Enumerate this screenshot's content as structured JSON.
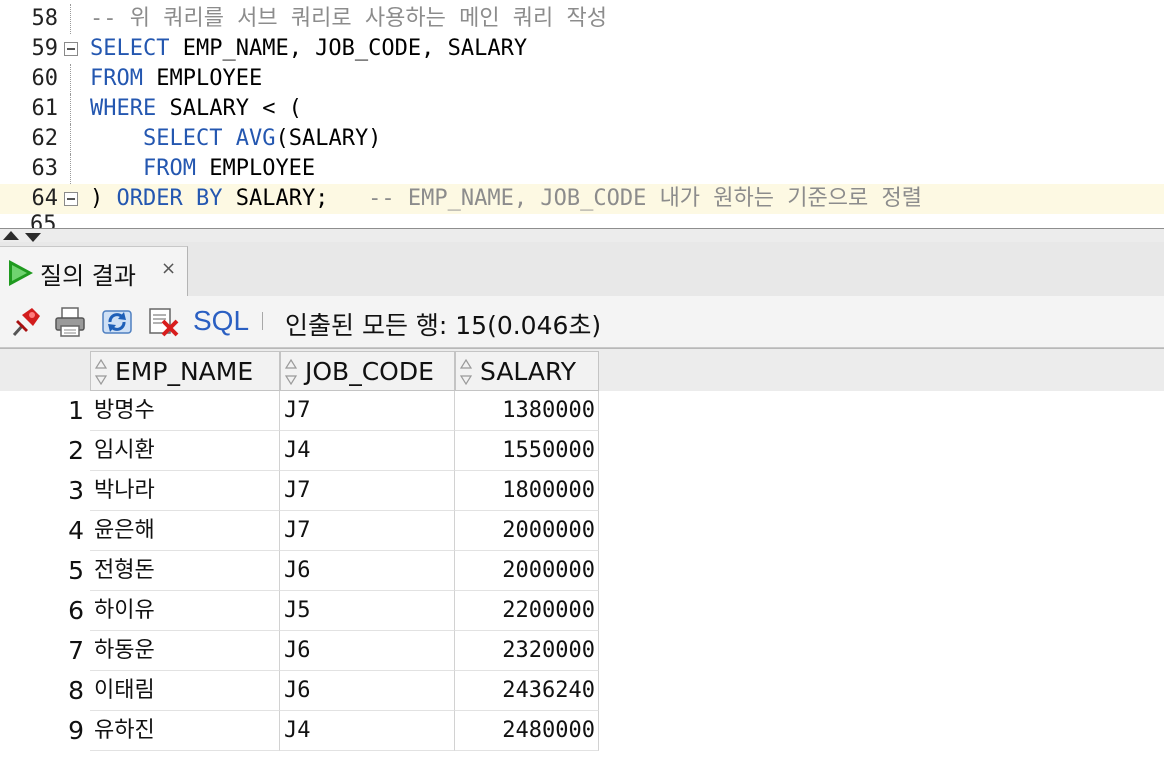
{
  "editor": {
    "lines": [
      {
        "number": "58",
        "fold": false,
        "current": false,
        "parts": [
          {
            "text": "-- 위 쿼리를 서브 쿼리로 사용하는 메인 쿼리 작성",
            "kind": "comment"
          }
        ]
      },
      {
        "number": "59",
        "fold": true,
        "current": false,
        "parts": [
          {
            "text": "SELECT",
            "kind": "keyword"
          },
          {
            "text": " EMP_NAME, JOB_CODE, SALARY",
            "kind": "plain"
          }
        ]
      },
      {
        "number": "60",
        "fold": false,
        "current": false,
        "parts": [
          {
            "text": "FROM",
            "kind": "keyword"
          },
          {
            "text": " EMPLOYEE",
            "kind": "plain"
          }
        ]
      },
      {
        "number": "61",
        "fold": false,
        "current": false,
        "parts": [
          {
            "text": "WHERE",
            "kind": "keyword"
          },
          {
            "text": " SALARY < (",
            "kind": "plain"
          }
        ]
      },
      {
        "number": "62",
        "fold": false,
        "current": false,
        "parts": [
          {
            "text": "    ",
            "kind": "plain"
          },
          {
            "text": "SELECT",
            "kind": "keyword"
          },
          {
            "text": " ",
            "kind": "plain"
          },
          {
            "text": "AVG",
            "kind": "keyword"
          },
          {
            "text": "(SALARY)",
            "kind": "plain"
          }
        ]
      },
      {
        "number": "63",
        "fold": false,
        "current": false,
        "parts": [
          {
            "text": "    ",
            "kind": "plain"
          },
          {
            "text": "FROM",
            "kind": "keyword"
          },
          {
            "text": " EMPLOYEE",
            "kind": "plain"
          }
        ]
      },
      {
        "number": "64",
        "fold": true,
        "current": true,
        "parts": [
          {
            "text": ") ",
            "kind": "plain"
          },
          {
            "text": "ORDER BY",
            "kind": "keyword"
          },
          {
            "text": " SALARY;   ",
            "kind": "plain"
          },
          {
            "text": "-- EMP_NAME, JOB_CODE 내가 원하는 기준으로 정렬",
            "kind": "comment"
          }
        ]
      }
    ],
    "partial_line_number": "65"
  },
  "results_tab": {
    "label": "질의 결과",
    "close_glyph": "×",
    "icon": "run-triangle-icon",
    "icon_color": "#1f9a1f"
  },
  "toolbar": {
    "icons": [
      "pin-icon",
      "print-icon",
      "refresh-icon",
      "delete-icon"
    ],
    "sql_label": "SQL",
    "status_text": "인출된 모든 행: 15(0.046초)"
  },
  "grid": {
    "columns": [
      "EMP_NAME",
      "JOB_CODE",
      "SALARY"
    ],
    "rows": [
      {
        "num": "1",
        "emp_name": "방명수",
        "job_code": "J7",
        "salary": "1380000"
      },
      {
        "num": "2",
        "emp_name": "임시환",
        "job_code": "J4",
        "salary": "1550000"
      },
      {
        "num": "3",
        "emp_name": "박나라",
        "job_code": "J7",
        "salary": "1800000"
      },
      {
        "num": "4",
        "emp_name": "윤은해",
        "job_code": "J7",
        "salary": "2000000"
      },
      {
        "num": "5",
        "emp_name": "전형돈",
        "job_code": "J6",
        "salary": "2000000"
      },
      {
        "num": "6",
        "emp_name": "하이유",
        "job_code": "J5",
        "salary": "2200000"
      },
      {
        "num": "7",
        "emp_name": "하동운",
        "job_code": "J6",
        "salary": "2320000"
      },
      {
        "num": "8",
        "emp_name": "이태림",
        "job_code": "J6",
        "salary": "2436240"
      },
      {
        "num": "9",
        "emp_name": "유하진",
        "job_code": "J4",
        "salary": "2480000"
      }
    ]
  },
  "colors": {
    "keyword": "#2457b0",
    "comment": "#8c8c8c",
    "current_line": "#fdf9e3",
    "sql_link": "#2a5fc2"
  }
}
